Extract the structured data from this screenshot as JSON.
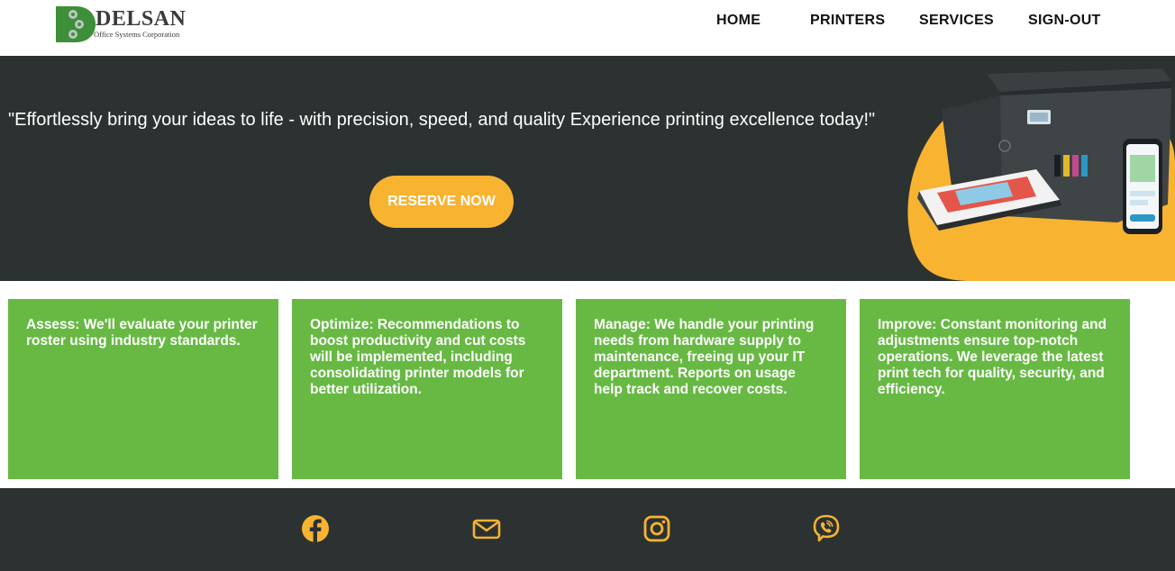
{
  "brand": {
    "name": "DELSAN",
    "subtitle": "Office Systems Corporation",
    "color": "#3d8f3a"
  },
  "nav": {
    "items": [
      {
        "label": "HOME"
      },
      {
        "label": "PRINTERS"
      },
      {
        "label": "SERVICES"
      },
      {
        "label": "SIGN-OUT"
      }
    ]
  },
  "hero": {
    "tagline": "\"Effortlessly bring your ideas to life - with precision, speed, and quality Experience printing excellence today!\"",
    "cta_label": "RESERVE NOW",
    "background": "#2b3231",
    "accent": "#f8b331"
  },
  "cards": [
    {
      "text": "Assess: We'll evaluate your printer roster using industry standards."
    },
    {
      "text": "Optimize: Recommendations to boost productivity and cut costs will be implemented, including consolidating printer models for better utilization."
    },
    {
      "text": "Manage: We handle your printing needs from hardware supply to maintenance, freeing up your IT department. Reports on usage help track and recover costs."
    },
    {
      "text": "Improve: Constant monitoring and adjustments ensure top-notch operations. We leverage the latest print tech for quality, security, and efficiency."
    }
  ],
  "card_color": "#67b943",
  "footer": {
    "icons": [
      "facebook-icon",
      "email-icon",
      "instagram-icon",
      "viber-icon"
    ],
    "icon_color": "#f8b331"
  }
}
